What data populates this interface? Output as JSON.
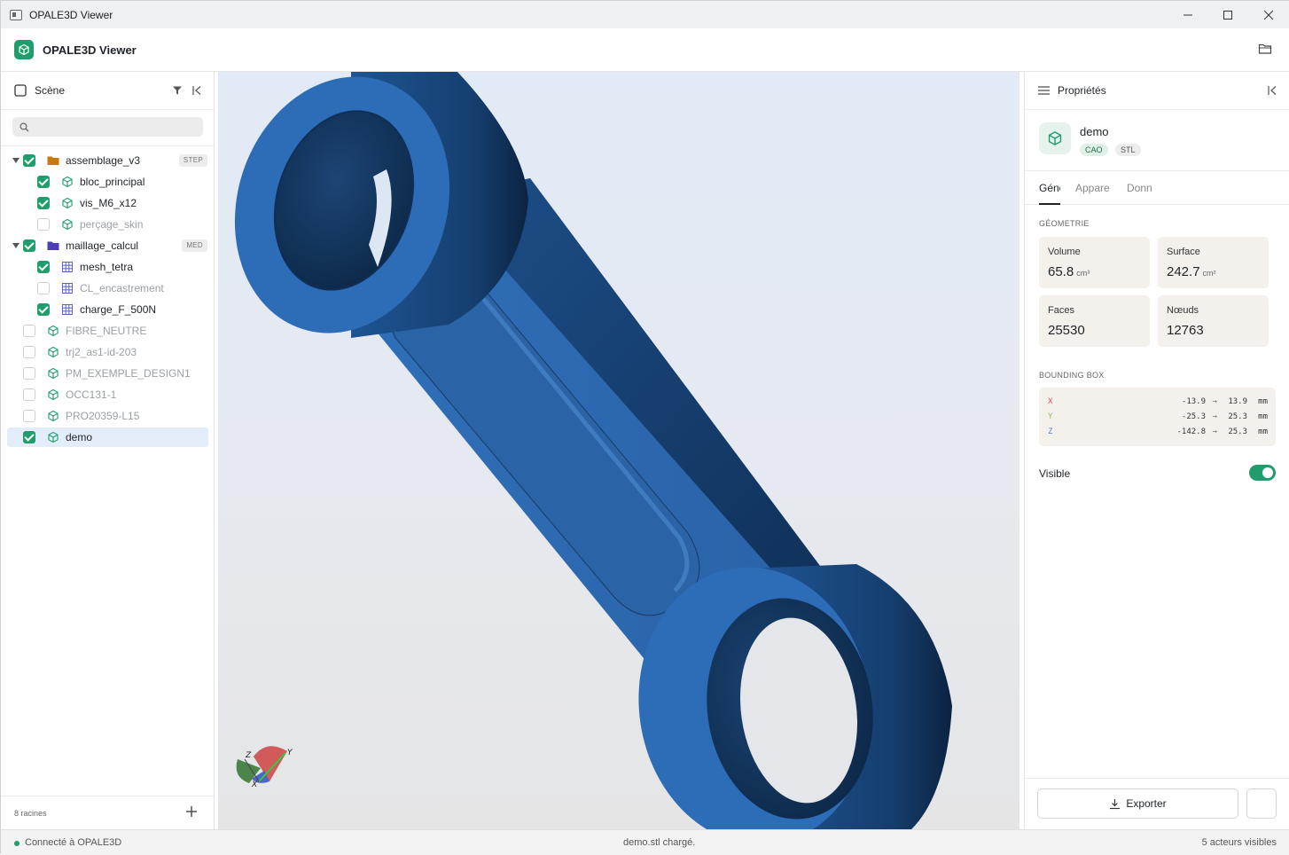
{
  "window": {
    "title": "OPALE3D Viewer"
  },
  "app": {
    "name": "OPALE3D Viewer"
  },
  "scene_panel": {
    "title": "Scène",
    "search_placeholder": "",
    "footer_count": "8 racines",
    "tree": [
      {
        "label": "assemblage_v3",
        "type": "folder",
        "checked": true,
        "level": 0,
        "expanded": true,
        "badge": "STEP",
        "folder_color": "#c8790f"
      },
      {
        "label": "bloc_principal",
        "type": "part",
        "checked": true,
        "level": 1
      },
      {
        "label": "vis_M6_x12",
        "type": "part",
        "checked": true,
        "level": 1
      },
      {
        "label": "perçage_skin",
        "type": "part",
        "checked": false,
        "level": 1
      },
      {
        "label": "maillage_calcul",
        "type": "folder",
        "checked": true,
        "level": 0,
        "expanded": true,
        "badge": "MED",
        "folder_color": "#4a3fb8"
      },
      {
        "label": "mesh_tetra",
        "type": "mesh",
        "checked": true,
        "level": 1
      },
      {
        "label": "CL_encastrement",
        "type": "mesh",
        "checked": false,
        "level": 1
      },
      {
        "label": "charge_F_500N",
        "type": "mesh",
        "checked": true,
        "level": 1
      },
      {
        "label": "FIBRE_NEUTRE",
        "type": "part",
        "checked": false,
        "level": 0
      },
      {
        "label": "trj2_as1-id-203",
        "type": "part",
        "checked": false,
        "level": 0
      },
      {
        "label": "PM_EXEMPLE_DESIGN1",
        "type": "part",
        "checked": false,
        "level": 0
      },
      {
        "label": "OCC131-1",
        "type": "part",
        "checked": false,
        "level": 0
      },
      {
        "label": "PRO20359-L15",
        "type": "part",
        "checked": false,
        "level": 0
      },
      {
        "label": "demo",
        "type": "part",
        "checked": true,
        "level": 0,
        "selected": true
      }
    ]
  },
  "viewport": {
    "model_color": "#2e6db4",
    "axes": {
      "x": "X",
      "y": "Y",
      "z": "Z"
    }
  },
  "properties_panel": {
    "title": "Propriétés",
    "object": {
      "name": "demo",
      "tags": [
        "CAO",
        "STL"
      ]
    },
    "tabs": [
      "Géné",
      "Appare",
      "Donn"
    ],
    "active_tab": 0,
    "geometry_title": "GÉOMETRIE",
    "metrics": [
      {
        "label": "Volume",
        "value": "65.8",
        "unit": "cm³"
      },
      {
        "label": "Surface",
        "value": "242.7",
        "unit": "cm²"
      },
      {
        "label": "Faces",
        "value": "25530",
        "unit": ""
      },
      {
        "label": "Nœuds",
        "value": "12763",
        "unit": ""
      }
    ],
    "bbox_title": "BOUNDING BOX",
    "bbox": [
      {
        "axis": "X",
        "min": "-13.9",
        "arrow": "→",
        "max": "13.9",
        "unit": "mm",
        "color": "#e05555"
      },
      {
        "axis": "Y",
        "min": "-25.3",
        "arrow": "→",
        "max": "25.3",
        "unit": "mm",
        "color": "#9bbf4a"
      },
      {
        "axis": "Z",
        "min": "-142.8",
        "arrow": "→",
        "max": "25.3",
        "unit": "mm",
        "color": "#5a7bd8"
      }
    ],
    "visible_label": "Visible",
    "visible": true,
    "export_label": "Exporter"
  },
  "status": {
    "connection": "Connecté à OPALE3D",
    "message": "demo.stl chargé.",
    "actors": "5  acteurs visibles"
  },
  "colors": {
    "accent": "#1f9d6b",
    "selection": "#e3edf9"
  }
}
